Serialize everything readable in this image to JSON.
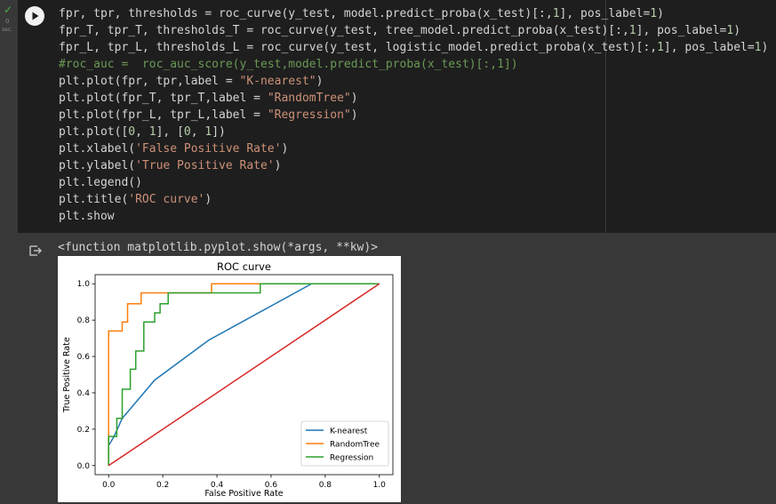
{
  "gutter": {
    "status_text": "0",
    "status_sub": "sec."
  },
  "cell": {
    "code_lines": [
      [
        {
          "t": "fpr, tpr, thresholds = roc_curve(y_test, model.predict_proba(x_test)[:,",
          "c": ""
        },
        {
          "t": "1",
          "c": "num"
        },
        {
          "t": "], pos_label=",
          "c": ""
        },
        {
          "t": "1",
          "c": "num"
        },
        {
          "t": ")",
          "c": ""
        }
      ],
      [
        {
          "t": "fpr_T, tpr_T, thresholds_T = roc_curve(y_test, tree_model.predict_proba(x_test)[:,",
          "c": ""
        },
        {
          "t": "1",
          "c": "num"
        },
        {
          "t": "], pos_label=",
          "c": ""
        },
        {
          "t": "1",
          "c": "num"
        },
        {
          "t": ")",
          "c": ""
        }
      ],
      [
        {
          "t": "fpr_L, tpr_L, thresholds_L = roc_curve(y_test, logistic_model.predict_proba(x_test)[:,",
          "c": ""
        },
        {
          "t": "1",
          "c": "num"
        },
        {
          "t": "], pos_label=",
          "c": ""
        },
        {
          "t": "1",
          "c": "num"
        },
        {
          "t": ")",
          "c": ""
        }
      ],
      [
        {
          "t": "#roc_auc =  roc_auc_score(y_test,model.predict_proba(x_test)[:,1])",
          "c": "com"
        }
      ],
      [
        {
          "t": "plt.plot(fpr, tpr,label = ",
          "c": ""
        },
        {
          "t": "\"K-nearest\"",
          "c": "str"
        },
        {
          "t": ")",
          "c": ""
        }
      ],
      [
        {
          "t": "plt.plot(fpr_T, tpr_T,label = ",
          "c": ""
        },
        {
          "t": "\"RandomTree\"",
          "c": "str"
        },
        {
          "t": ")",
          "c": ""
        }
      ],
      [
        {
          "t": "plt.plot(fpr_L, tpr_L,label = ",
          "c": ""
        },
        {
          "t": "\"Regression\"",
          "c": "str"
        },
        {
          "t": ")",
          "c": ""
        }
      ],
      [
        {
          "t": "plt.plot([",
          "c": ""
        },
        {
          "t": "0",
          "c": "num"
        },
        {
          "t": ", ",
          "c": ""
        },
        {
          "t": "1",
          "c": "num"
        },
        {
          "t": "], [",
          "c": ""
        },
        {
          "t": "0",
          "c": "num"
        },
        {
          "t": ", ",
          "c": ""
        },
        {
          "t": "1",
          "c": "num"
        },
        {
          "t": "])",
          "c": ""
        }
      ],
      [
        {
          "t": "plt.xlabel(",
          "c": ""
        },
        {
          "t": "'False Positive Rate'",
          "c": "str"
        },
        {
          "t": ")",
          "c": ""
        }
      ],
      [
        {
          "t": "plt.ylabel(",
          "c": ""
        },
        {
          "t": "'True Positive Rate'",
          "c": "str"
        },
        {
          "t": ")",
          "c": ""
        }
      ],
      [
        {
          "t": "plt.legend()",
          "c": ""
        }
      ],
      [
        {
          "t": "plt.title(",
          "c": ""
        },
        {
          "t": "'ROC curve'",
          "c": "str"
        },
        {
          "t": ")",
          "c": ""
        }
      ],
      [
        {
          "t": "plt.show",
          "c": ""
        }
      ]
    ]
  },
  "output": {
    "text": "<function matplotlib.pyplot.show(*args, **kw)>"
  },
  "colors": {
    "k_nearest": "#1f77b4",
    "random_tree": "#ff7f0e",
    "regression": "#2ca02c",
    "diagonal": "#d62728"
  },
  "chart_data": {
    "type": "line",
    "title": "ROC curve",
    "xlabel": "False Positive Rate",
    "ylabel": "True Positive Rate",
    "xlim": [
      -0.05,
      1.05
    ],
    "ylim": [
      -0.05,
      1.05
    ],
    "xticks": [
      "0.0",
      "0.2",
      "0.4",
      "0.6",
      "0.8",
      "1.0"
    ],
    "yticks": [
      "0.0",
      "0.2",
      "0.4",
      "0.6",
      "0.8",
      "1.0"
    ],
    "grid": false,
    "legend_position": "lower-right",
    "series": [
      {
        "name": "K-nearest",
        "color": "#1f77b4",
        "x": [
          0,
          0,
          0.02,
          0.05,
          0.17,
          0.37,
          0.75,
          1.0
        ],
        "y": [
          0,
          0.11,
          0.16,
          0.26,
          0.47,
          0.69,
          1.0,
          1.0
        ]
      },
      {
        "name": "RandomTree",
        "color": "#ff7f0e",
        "x": [
          0,
          0,
          0.05,
          0.05,
          0.07,
          0.07,
          0.12,
          0.12,
          0.22,
          0.22,
          0.38,
          0.38,
          1.0
        ],
        "y": [
          0,
          0.74,
          0.74,
          0.79,
          0.79,
          0.89,
          0.89,
          0.95,
          0.95,
          0.95,
          0.95,
          1.0,
          1.0
        ]
      },
      {
        "name": "Regression",
        "color": "#2ca02c",
        "x": [
          0,
          0,
          0.03,
          0.03,
          0.05,
          0.05,
          0.08,
          0.08,
          0.1,
          0.1,
          0.13,
          0.13,
          0.17,
          0.17,
          0.19,
          0.19,
          0.22,
          0.22,
          0.56,
          0.56,
          0.75,
          1.0
        ],
        "y": [
          0,
          0.16,
          0.16,
          0.26,
          0.26,
          0.42,
          0.42,
          0.53,
          0.53,
          0.63,
          0.63,
          0.79,
          0.79,
          0.84,
          0.84,
          0.89,
          0.89,
          0.95,
          0.95,
          1.0,
          1.0,
          1.0
        ]
      },
      {
        "color": "#d62728",
        "x": [
          0,
          1
        ],
        "y": [
          0,
          1
        ]
      }
    ]
  }
}
